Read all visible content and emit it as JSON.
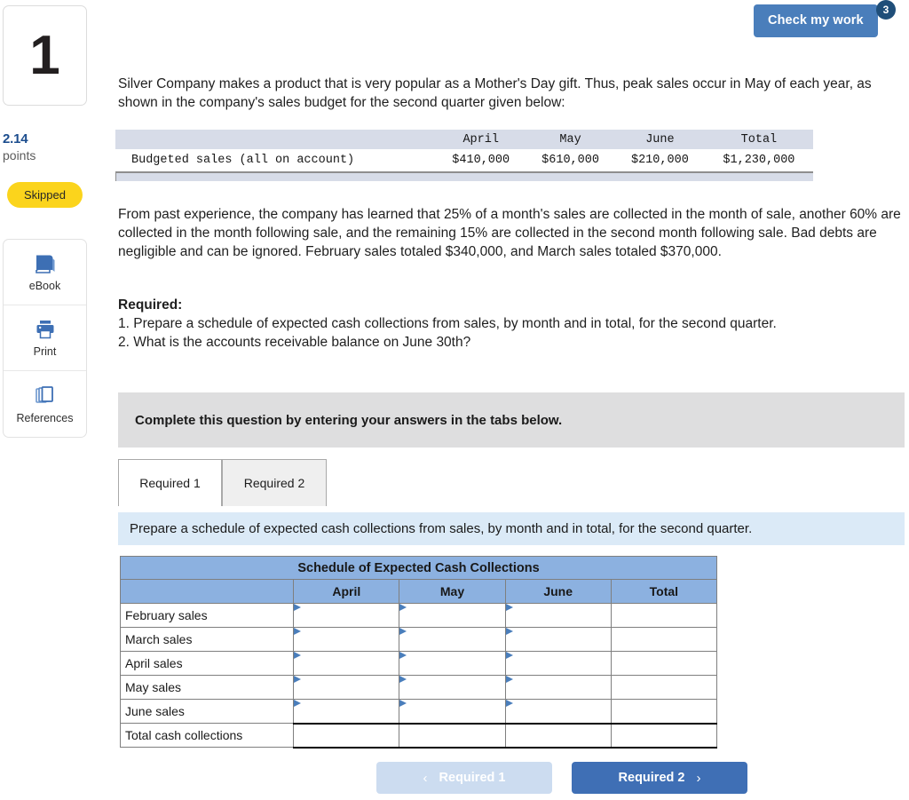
{
  "question": {
    "number": "1",
    "points_value": "2.14",
    "points_label": "points",
    "status_badge": "Skipped"
  },
  "tools": [
    {
      "label": "eBook",
      "icon": "ebook-icon"
    },
    {
      "label": "Print",
      "icon": "printer-icon"
    },
    {
      "label": "References",
      "icon": "references-icon"
    }
  ],
  "header": {
    "check_work_label": "Check my work",
    "check_work_badge": "3"
  },
  "body": {
    "intro": "Silver Company makes a product that is very popular as a Mother's Day gift. Thus, peak sales occur in May of each year, as shown in the company's sales budget for the second quarter given below:",
    "policy": "From past experience, the company has learned that 25% of a month's sales are collected in the month of sale, another 60% are collected in the month following sale, and the remaining 15% are collected in the second month following sale. Bad debts are negligible and can be ignored. February sales totaled $340,000, and March sales totaled $370,000.",
    "required_title": "Required:",
    "required_1": "1. Prepare a schedule of expected cash collections from sales, by month and in total, for the second quarter.",
    "required_2": "2. What is the accounts receivable balance on June 30th?"
  },
  "budget_table": {
    "columns": [
      "",
      "April",
      "May",
      "June",
      "Total"
    ],
    "rows": [
      {
        "label": "Budgeted sales (all on account)",
        "values": [
          "$410,000",
          "$610,000",
          "$210,000",
          "$1,230,000"
        ]
      }
    ]
  },
  "complete_banner": {
    "text": "Complete this question by entering your answers in the tabs below."
  },
  "tabs": [
    {
      "label": "Required 1",
      "active": true
    },
    {
      "label": "Required 2",
      "active": false
    }
  ],
  "prompt": {
    "text": "Prepare a schedule of expected cash collections from sales, by month and in total, for the second quarter."
  },
  "answer_table": {
    "title": "Schedule of Expected Cash Collections",
    "columns": [
      "",
      "April",
      "May",
      "June",
      "Total"
    ],
    "rows": [
      {
        "label": "February sales",
        "cells": [
          "",
          "",
          "",
          ""
        ],
        "total_row": false
      },
      {
        "label": "March sales",
        "cells": [
          "",
          "",
          "",
          ""
        ],
        "total_row": false
      },
      {
        "label": "April sales",
        "cells": [
          "",
          "",
          "",
          ""
        ],
        "total_row": false
      },
      {
        "label": "May sales",
        "cells": [
          "",
          "",
          "",
          ""
        ],
        "total_row": false
      },
      {
        "label": "June sales",
        "cells": [
          "",
          "",
          "",
          ""
        ],
        "total_row": false
      },
      {
        "label": "Total cash collections",
        "cells": [
          "",
          "",
          "",
          ""
        ],
        "total_row": true
      }
    ]
  },
  "nav": {
    "prev_label": "Required 1",
    "prev_chevron": "‹",
    "next_label": "Required 2",
    "next_chevron": "›"
  },
  "colors": {
    "accent_blue": "#4a7ebb",
    "nav_blue": "#3f6fb5",
    "table_header_blue": "#8cb1e0",
    "prompt_blue": "#dbeaf7",
    "banner_gray": "#dededf",
    "skipped_yellow": "#fbd41c",
    "points_blue": "#1c4d8e",
    "badge_navy": "#1f4e79"
  }
}
